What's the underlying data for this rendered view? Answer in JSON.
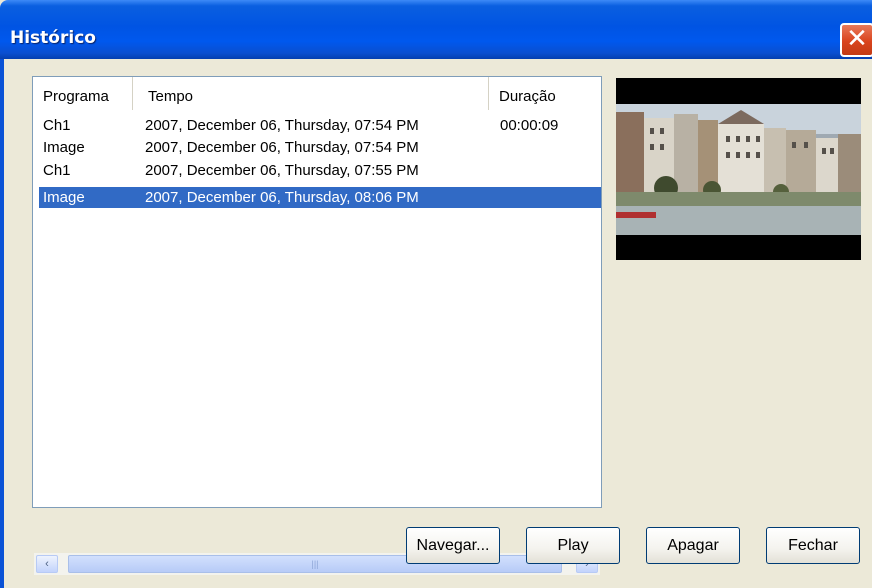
{
  "window": {
    "title": "Histórico",
    "close_glyph": "✕"
  },
  "list": {
    "columns": [
      "Programa",
      "Tempo",
      "Duração"
    ],
    "rows": [
      {
        "programa": "Ch1",
        "tempo": "2007, December 06, Thursday, 07:54 PM",
        "duracao": "00:00:09"
      },
      {
        "programa": "Image",
        "tempo": "2007, December 06, Thursday, 07:54 PM",
        "duracao": ""
      },
      {
        "programa": "Ch1",
        "tempo": "2007, December 06, Thursday, 07:55 PM",
        "duracao": ""
      },
      {
        "programa": "Image",
        "tempo": "2007, December 06, Thursday, 08:06 PM",
        "duracao": ""
      }
    ],
    "selected_index": 3,
    "scroll_left_glyph": "‹",
    "scroll_right_glyph": "›",
    "scroll_grip_glyph": "|||"
  },
  "buttons": {
    "navegar": "Navegar...",
    "play": "Play",
    "apagar": "Apagar",
    "fechar": "Fechar"
  },
  "colors": {
    "titlebar": "#0054e3",
    "selection": "#316ac5",
    "close": "#d9441d"
  }
}
